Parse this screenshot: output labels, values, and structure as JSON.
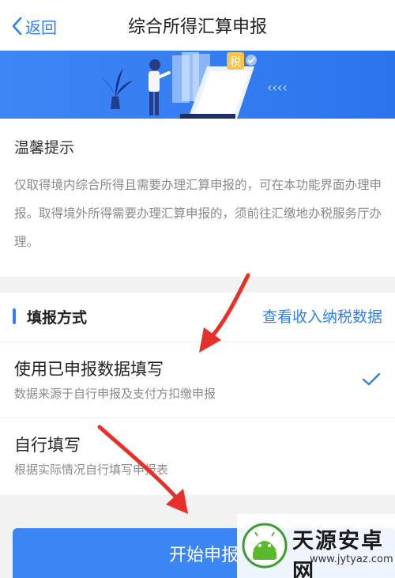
{
  "header": {
    "back_label": "返回",
    "title": "综合所得汇算申报"
  },
  "banner": {
    "tax_badge": "税",
    "chevrons": "‹‹‹‹"
  },
  "tips": {
    "title": "温馨提示",
    "body": "仅取得境内综合所得且需要办理汇算申报的，可在本功能界面办理申报。取得境外所得需要办理汇算申报的，须前往汇缴地办税服务厅办理。"
  },
  "method": {
    "section_title": "填报方式",
    "link_label": "查看收入纳税数据",
    "options": [
      {
        "title": "使用已申报数据填写",
        "desc": "数据来源于自行申报及支付方扣缴申报",
        "selected": true
      },
      {
        "title": "自行填写",
        "desc": "根据实际情况自行填写申报表",
        "selected": false
      }
    ]
  },
  "start_button": {
    "label": "开始申报"
  },
  "watermark": {
    "name": "天源安卓网",
    "url": "www.jytyaz.com"
  },
  "colors": {
    "accent": "#2f7ff0",
    "button": "#3a86f4",
    "arrow": "#e8302a"
  }
}
